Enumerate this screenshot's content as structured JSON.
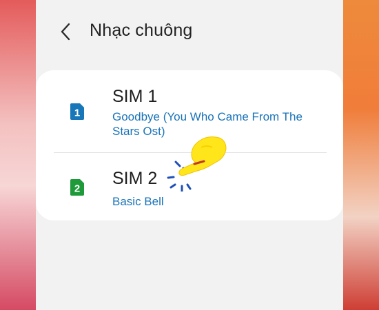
{
  "header": {
    "title": "Nhạc chuông",
    "back_icon": "chevron-left-icon"
  },
  "sims": [
    {
      "name": "SIM 1",
      "ringtone": "Goodbye (You Who Came From The Stars Ost)",
      "badge": "1",
      "badge_color": "#1877b8",
      "icon": "sim-card-icon"
    },
    {
      "name": "SIM 2",
      "ringtone": "Basic Bell",
      "badge": "2",
      "badge_color": "#1f9a3a",
      "icon": "sim-card-icon"
    }
  ],
  "colors": {
    "accent_text": "#1a73b8",
    "screen_bg": "#f2f2f2",
    "card_bg": "#ffffff",
    "pointer_hand": "#ffe61a"
  },
  "overlay": {
    "icon": "pointing-hand-icon"
  }
}
